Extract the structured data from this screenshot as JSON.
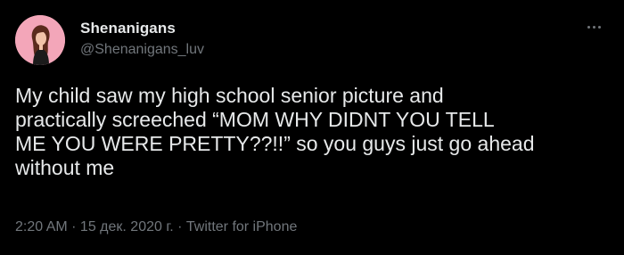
{
  "author": {
    "display_name": "Shenanigans",
    "handle": "@Shenanigans_luv",
    "avatar_icon": "avatar-illustration-icon",
    "avatar_bg": "#f3a6b9"
  },
  "tweet": {
    "text": "My child saw my high school senior picture and\npractically screeched “MOM WHY DIDNT YOU TELL\nME YOU WERE PRETTY??!!” so you guys just go ahead\nwithout me"
  },
  "meta": {
    "line": "2:20 AM · 15 дек. 2020 г. · Twitter for iPhone"
  },
  "menu": {
    "icon": "more-options-icon"
  },
  "colors": {
    "background": "#000000",
    "text_primary": "#e7e9ea",
    "text_secondary": "#71767b"
  }
}
